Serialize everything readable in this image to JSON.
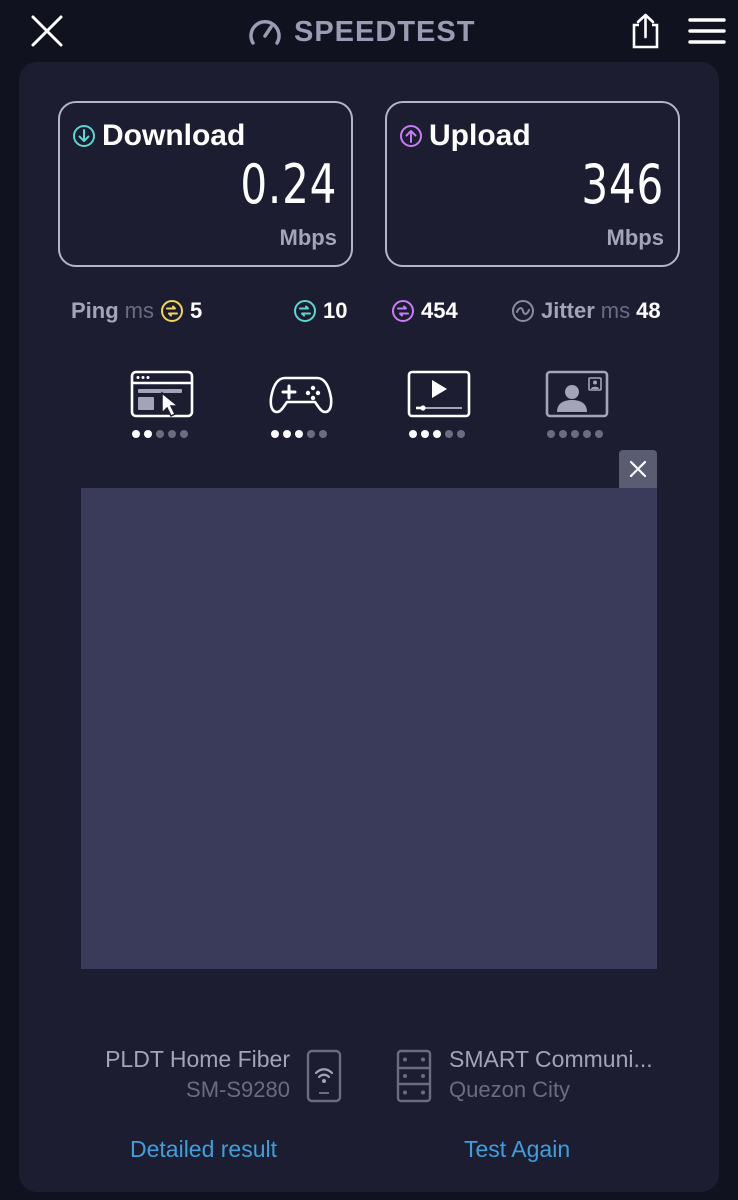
{
  "header": {
    "title": "SPEEDTEST",
    "close_icon": "close-icon",
    "share_icon": "share-icon",
    "menu_icon": "hamburger-menu-icon"
  },
  "download": {
    "label": "Download",
    "value": "0.24",
    "unit": "Mbps",
    "color": "#5ad7d0"
  },
  "upload": {
    "label": "Upload",
    "value": "346",
    "unit": "Mbps",
    "color": "#c77df5"
  },
  "ping": {
    "label": "Ping",
    "unit": "ms",
    "idle": "5",
    "download": "10",
    "upload": "454",
    "idle_color": "#f2d45a",
    "download_color": "#5ad7d0",
    "upload_color": "#c77df5"
  },
  "jitter": {
    "label": "Jitter",
    "unit": "ms",
    "value": "48"
  },
  "quality": [
    {
      "icon": "web-browsing-icon",
      "rating": 2,
      "max": 5
    },
    {
      "icon": "gaming-icon",
      "rating": 3,
      "max": 5
    },
    {
      "icon": "video-streaming-icon",
      "rating": 3,
      "max": 5
    },
    {
      "icon": "video-call-icon",
      "rating": 0,
      "max": 5
    }
  ],
  "provider": {
    "name": "PLDT Home Fiber",
    "device": "SM-S9280"
  },
  "server": {
    "name": "SMART Communi...",
    "city": "Quezon City"
  },
  "links": {
    "detailed": "Detailed result",
    "again": "Test Again"
  },
  "colors": {
    "background": "#11121f",
    "card": "#1c1d31",
    "link": "#3f9fdc",
    "ad_placeholder": "#3a3a5a"
  }
}
